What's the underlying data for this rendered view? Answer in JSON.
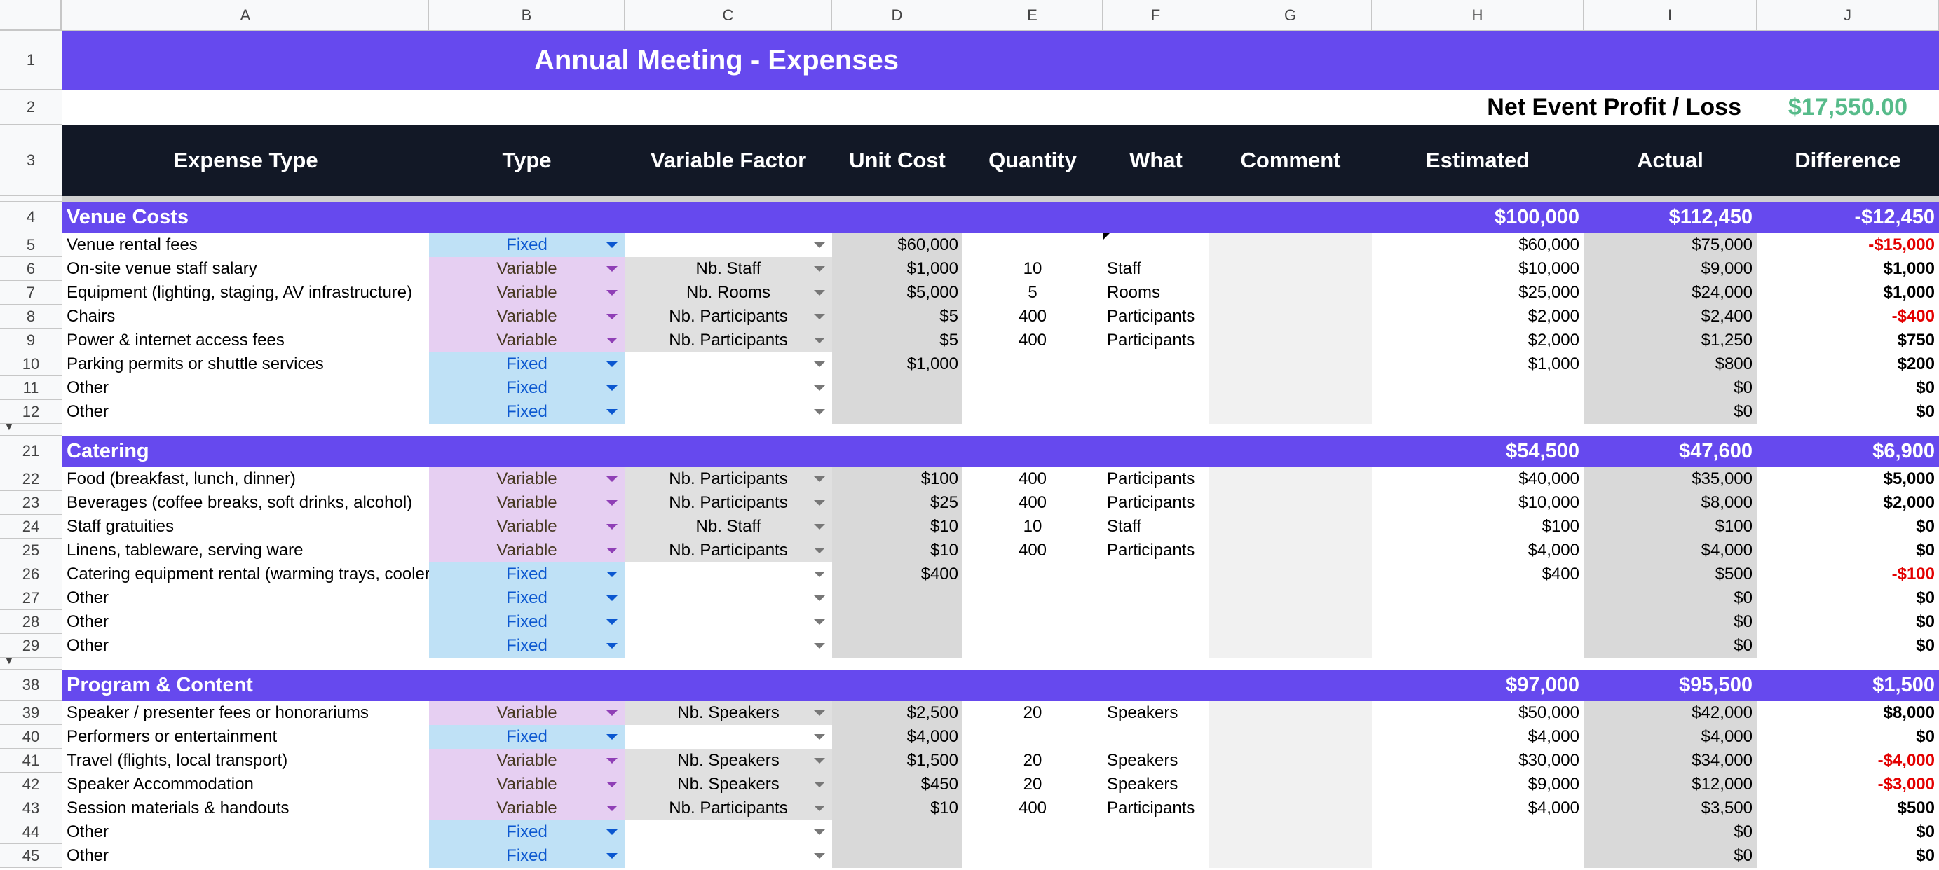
{
  "columns": [
    "A",
    "B",
    "C",
    "D",
    "E",
    "F",
    "G",
    "H",
    "I",
    "J"
  ],
  "title": "Annual Meeting -  Expenses",
  "profit": {
    "label": "Net Event Profit / Loss",
    "value": "$17,550.00"
  },
  "headers": {
    "expense_type": "Expense Type",
    "type": "Type",
    "variable_factor": "Variable Factor",
    "unit_cost": "Unit Cost",
    "quantity": "Quantity",
    "what": "What",
    "comment": "Comment",
    "estimated": "Estimated",
    "actual": "Actual",
    "difference": "Difference"
  },
  "row_numbers": {
    "r1": "1",
    "r2": "2",
    "r3": "3",
    "r4": "4",
    "r5": "5",
    "r6": "6",
    "r7": "7",
    "r8": "8",
    "r9": "9",
    "r10": "10",
    "r11": "11",
    "r12": "12",
    "r21": "21",
    "r22": "22",
    "r23": "23",
    "r24": "24",
    "r25": "25",
    "r26": "26",
    "r27": "27",
    "r28": "28",
    "r29": "29",
    "r38": "38",
    "r39": "39",
    "r40": "40",
    "r41": "41",
    "r42": "42",
    "r43": "43",
    "r44": "44",
    "r45": "45"
  },
  "sections": {
    "venue": {
      "name": "Venue Costs",
      "estimated": "$100,000",
      "actual": "$112,450",
      "difference": "-$12,450"
    },
    "catering": {
      "name": "Catering",
      "estimated": "$54,500",
      "actual": "$47,600",
      "difference": "$6,900"
    },
    "program": {
      "name": "Program & Content",
      "estimated": "$97,000",
      "actual": "$95,500",
      "difference": "$1,500"
    }
  },
  "rows": {
    "r5": {
      "name": "Venue rental fees",
      "type": "Fixed",
      "factor": "",
      "unit": "$60,000",
      "qty": "",
      "what": "",
      "est": "$60,000",
      "act": "$75,000",
      "diff": "-$15,000"
    },
    "r6": {
      "name": "On-site venue staff salary",
      "type": "Variable",
      "factor": "Nb. Staff",
      "unit": "$1,000",
      "qty": "10",
      "what": "Staff",
      "est": "$10,000",
      "act": "$9,000",
      "diff": "$1,000"
    },
    "r7": {
      "name": "Equipment (lighting, staging, AV infrastructure)",
      "type": "Variable",
      "factor": "Nb. Rooms",
      "unit": "$5,000",
      "qty": "5",
      "what": "Rooms",
      "est": "$25,000",
      "act": "$24,000",
      "diff": "$1,000"
    },
    "r8": {
      "name": "Chairs",
      "type": "Variable",
      "factor": "Nb. Participants",
      "unit": "$5",
      "qty": "400",
      "what": "Participants",
      "est": "$2,000",
      "act": "$2,400",
      "diff": "-$400"
    },
    "r9": {
      "name": "Power & internet access fees",
      "type": "Variable",
      "factor": "Nb. Participants",
      "unit": "$5",
      "qty": "400",
      "what": "Participants",
      "est": "$2,000",
      "act": "$1,250",
      "diff": "$750"
    },
    "r10": {
      "name": "Parking permits or shuttle services",
      "type": "Fixed",
      "factor": "",
      "unit": "$1,000",
      "qty": "",
      "what": "",
      "est": "$1,000",
      "act": "$800",
      "diff": "$200"
    },
    "r11": {
      "name": "Other",
      "type": "Fixed",
      "factor": "",
      "unit": "",
      "qty": "",
      "what": "",
      "est": "",
      "act": "$0",
      "diff": "$0"
    },
    "r12": {
      "name": "Other",
      "type": "Fixed",
      "factor": "",
      "unit": "",
      "qty": "",
      "what": "",
      "est": "",
      "act": "$0",
      "diff": "$0"
    },
    "r22": {
      "name": "Food (breakfast, lunch, dinner)",
      "type": "Variable",
      "factor": "Nb. Participants",
      "unit": "$100",
      "qty": "400",
      "what": "Participants",
      "est": "$40,000",
      "act": "$35,000",
      "diff": "$5,000"
    },
    "r23": {
      "name": "Beverages (coffee breaks, soft drinks, alcohol)",
      "type": "Variable",
      "factor": "Nb. Participants",
      "unit": "$25",
      "qty": "400",
      "what": "Participants",
      "est": "$10,000",
      "act": "$8,000",
      "diff": "$2,000"
    },
    "r24": {
      "name": "Staff gratuities",
      "type": "Variable",
      "factor": "Nb. Staff",
      "unit": "$10",
      "qty": "10",
      "what": "Staff",
      "est": "$100",
      "act": "$100",
      "diff": "$0"
    },
    "r25": {
      "name": "Linens, tableware, serving ware",
      "type": "Variable",
      "factor": "Nb. Participants",
      "unit": "$10",
      "qty": "400",
      "what": "Participants",
      "est": "$4,000",
      "act": "$4,000",
      "diff": "$0"
    },
    "r26": {
      "name": "Catering equipment rental (warming trays, cooler",
      "type": "Fixed",
      "factor": "",
      "unit": "$400",
      "qty": "",
      "what": "",
      "est": "$400",
      "act": "$500",
      "diff": "-$100"
    },
    "r27": {
      "name": "Other",
      "type": "Fixed",
      "factor": "",
      "unit": "",
      "qty": "",
      "what": "",
      "est": "",
      "act": "$0",
      "diff": "$0"
    },
    "r28": {
      "name": "Other",
      "type": "Fixed",
      "factor": "",
      "unit": "",
      "qty": "",
      "what": "",
      "est": "",
      "act": "$0",
      "diff": "$0"
    },
    "r29": {
      "name": "Other",
      "type": "Fixed",
      "factor": "",
      "unit": "",
      "qty": "",
      "what": "",
      "est": "",
      "act": "$0",
      "diff": "$0"
    },
    "r39": {
      "name": "Speaker / presenter fees or honorariums",
      "type": "Variable",
      "factor": "Nb. Speakers",
      "unit": "$2,500",
      "qty": "20",
      "what": "Speakers",
      "est": "$50,000",
      "act": "$42,000",
      "diff": "$8,000"
    },
    "r40": {
      "name": "Performers or entertainment",
      "type": "Fixed",
      "factor": "",
      "unit": "$4,000",
      "qty": "",
      "what": "",
      "est": "$4,000",
      "act": "$4,000",
      "diff": "$0"
    },
    "r41": {
      "name": "Travel (flights, local transport)",
      "type": "Variable",
      "factor": "Nb. Speakers",
      "unit": "$1,500",
      "qty": "20",
      "what": "Speakers",
      "est": "$30,000",
      "act": "$34,000",
      "diff": "-$4,000"
    },
    "r42": {
      "name": "Speaker Accommodation",
      "type": "Variable",
      "factor": "Nb. Speakers",
      "unit": "$450",
      "qty": "20",
      "what": "Speakers",
      "est": "$9,000",
      "act": "$12,000",
      "diff": "-$3,000"
    },
    "r43": {
      "name": "Session materials & handouts",
      "type": "Variable",
      "factor": "Nb. Participants",
      "unit": "$10",
      "qty": "400",
      "what": "Participants",
      "est": "$4,000",
      "act": "$3,500",
      "diff": "$500"
    },
    "r44": {
      "name": "Other",
      "type": "Fixed",
      "factor": "",
      "unit": "",
      "qty": "",
      "what": "",
      "est": "",
      "act": "$0",
      "diff": "$0"
    },
    "r45": {
      "name": "Other",
      "type": "Fixed",
      "factor": "",
      "unit": "",
      "qty": "",
      "what": "",
      "est": "",
      "act": "$0",
      "diff": "$0"
    }
  },
  "colors": {
    "accent": "#6649ee",
    "header_bg": "#121826",
    "fixed": "#bfe1f6",
    "variable": "#e6cff2",
    "negative": "#e30000",
    "profit": "#57bb8a"
  }
}
